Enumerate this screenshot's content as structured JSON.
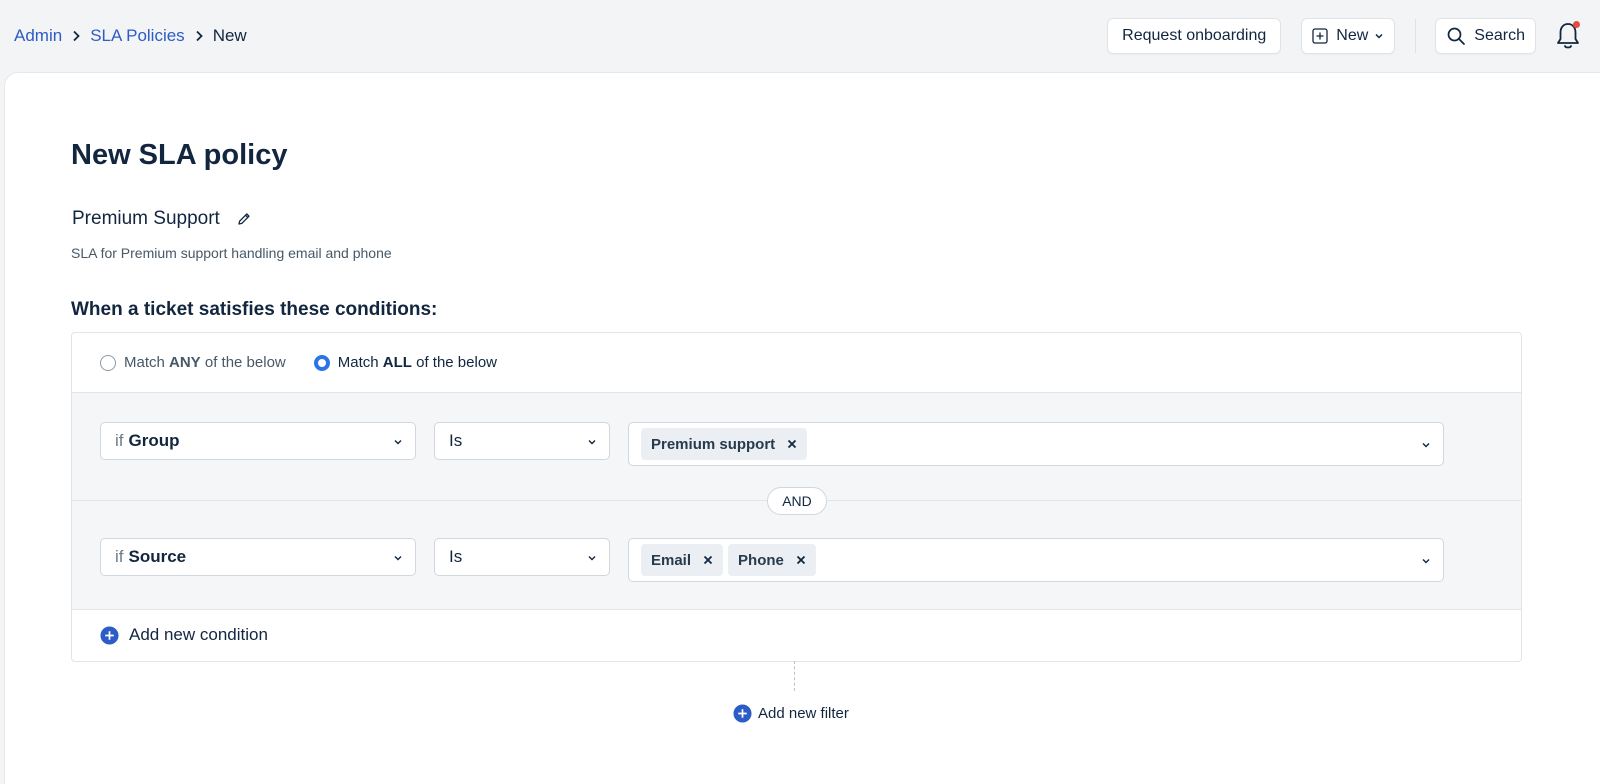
{
  "breadcrumb": {
    "items": [
      "Admin",
      "SLA Policies"
    ],
    "current": "New"
  },
  "toolbar": {
    "onboarding_label": "Request onboarding",
    "new_label": "New",
    "search_label": "Search",
    "has_notification": true
  },
  "page": {
    "title": "New SLA policy",
    "policy_name": "Premium Support",
    "policy_description": "SLA for Premium support handling email and phone",
    "conditions_heading": "When a ticket satisfies these conditions:"
  },
  "match": {
    "any": {
      "prefix": "Match ",
      "bold": "ANY",
      "suffix": " of the below",
      "selected": false
    },
    "all": {
      "prefix": "Match ",
      "bold": "ALL",
      "suffix": " of the below",
      "selected": true
    }
  },
  "conditions": [
    {
      "prefix": "if",
      "field": "Group",
      "operator": "Is",
      "values": [
        "Premium support"
      ]
    },
    {
      "prefix": "if",
      "field": "Source",
      "operator": "Is",
      "values": [
        "Email",
        "Phone"
      ]
    }
  ],
  "joiner_label": "AND",
  "add_condition_label": "Add new condition",
  "add_filter_label": "Add new filter",
  "colors": {
    "accent": "#2c5cc5",
    "radio_active": "#2c74e9",
    "notification_dot": "#e54d42"
  }
}
